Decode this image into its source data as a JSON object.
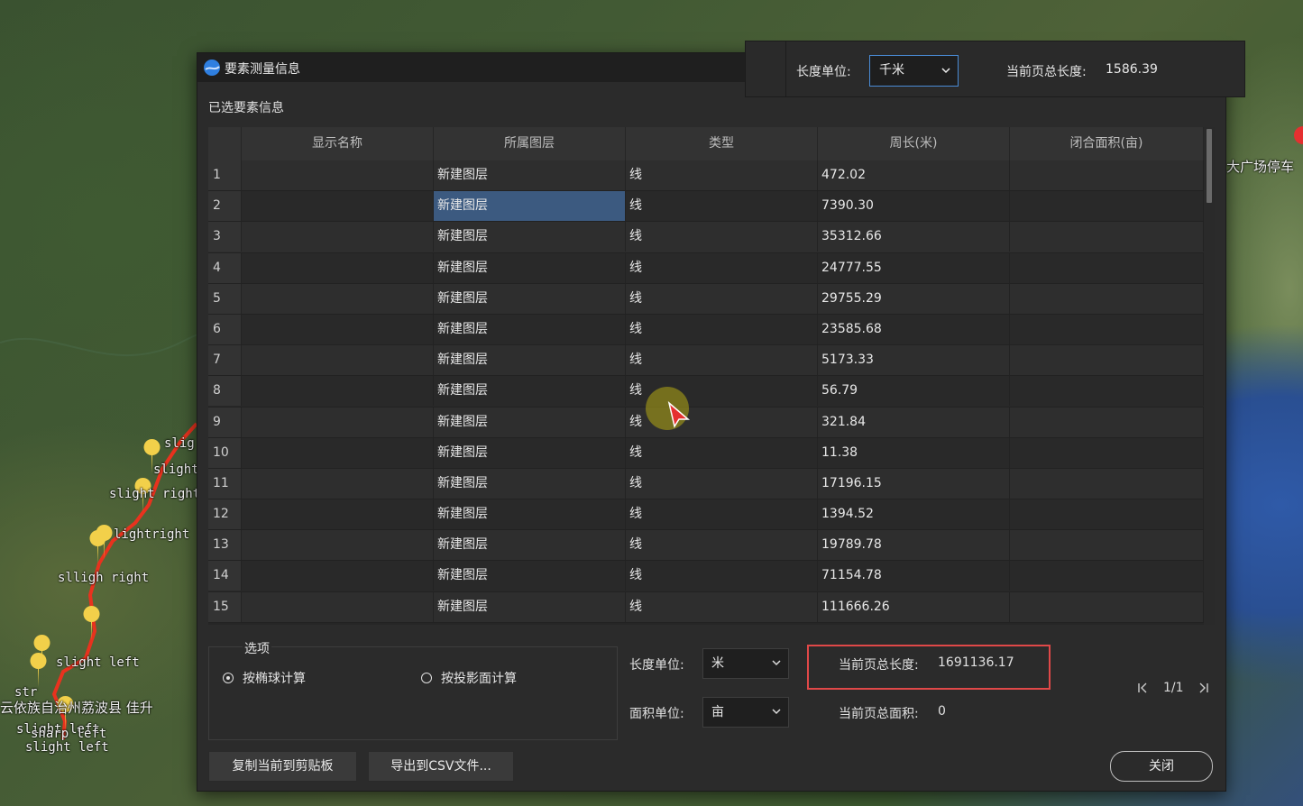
{
  "map": {
    "labels": {
      "parking": "大广场停车",
      "county": "云依族自治州荔波县 佳升",
      "route1": "slig",
      "route2": "slight",
      "route3": "slight right",
      "route4": "lightright",
      "route5": "slligh right",
      "route6": "slight left",
      "route7": "str",
      "route8": "slight left",
      "route9": "sharp left",
      "route10": "slight left"
    },
    "colors": {
      "route": "#e8321e",
      "pin": "#f2d04a",
      "marker": "#e53030"
    }
  },
  "dialog": {
    "title": "要素测量信息",
    "section_title": "已选要素信息",
    "table": {
      "headers": [
        "",
        "显示名称",
        "所属图层",
        "类型",
        "周长(米)",
        "闭合面积(亩)"
      ],
      "rows": [
        {
          "idx": "1",
          "name": "",
          "layer": "新建图层",
          "type": "线",
          "length": "472.02",
          "area": ""
        },
        {
          "idx": "2",
          "name": "",
          "layer": "新建图层",
          "type": "线",
          "length": "7390.30",
          "area": ""
        },
        {
          "idx": "3",
          "name": "",
          "layer": "新建图层",
          "type": "线",
          "length": "35312.66",
          "area": ""
        },
        {
          "idx": "4",
          "name": "",
          "layer": "新建图层",
          "type": "线",
          "length": "24777.55",
          "area": ""
        },
        {
          "idx": "5",
          "name": "",
          "layer": "新建图层",
          "type": "线",
          "length": "29755.29",
          "area": ""
        },
        {
          "idx": "6",
          "name": "",
          "layer": "新建图层",
          "type": "线",
          "length": "23585.68",
          "area": ""
        },
        {
          "idx": "7",
          "name": "",
          "layer": "新建图层",
          "type": "线",
          "length": "5173.33",
          "area": ""
        },
        {
          "idx": "8",
          "name": "",
          "layer": "新建图层",
          "type": "线",
          "length": "56.79",
          "area": ""
        },
        {
          "idx": "9",
          "name": "",
          "layer": "新建图层",
          "type": "线",
          "length": "321.84",
          "area": ""
        },
        {
          "idx": "10",
          "name": "",
          "layer": "新建图层",
          "type": "线",
          "length": "11.38",
          "area": ""
        },
        {
          "idx": "11",
          "name": "",
          "layer": "新建图层",
          "type": "线",
          "length": "17196.15",
          "area": ""
        },
        {
          "idx": "12",
          "name": "",
          "layer": "新建图层",
          "type": "线",
          "length": "1394.52",
          "area": ""
        },
        {
          "idx": "13",
          "name": "",
          "layer": "新建图层",
          "type": "线",
          "length": "19789.78",
          "area": ""
        },
        {
          "idx": "14",
          "name": "",
          "layer": "新建图层",
          "type": "线",
          "length": "71154.78",
          "area": ""
        },
        {
          "idx": "15",
          "name": "",
          "layer": "新建图层",
          "type": "线",
          "length": "111666.26",
          "area": ""
        }
      ],
      "selected_row": 2
    },
    "options": {
      "legend": "选项",
      "radio_ellipsoid": "按椭球计算",
      "radio_projection": "按投影面计算",
      "selected": "ellipsoid"
    },
    "units": {
      "length_label": "长度单位:",
      "length_value": "米",
      "area_label": "面积单位:",
      "area_value": "亩"
    },
    "summary": {
      "total_length_label": "当前页总长度:",
      "total_length_value": "1691136.17",
      "total_area_label": "当前页总面积:",
      "total_area_value": "0"
    },
    "pager": {
      "text": "1/1"
    },
    "buttons": {
      "copy": "复制当前到剪贴板",
      "export": "导出到CSV文件...",
      "close": "关闭"
    }
  },
  "overlay": {
    "length_label": "长度单位:",
    "length_value": "千米",
    "total_label": "当前页总长度:",
    "total_value": "1586.39"
  }
}
